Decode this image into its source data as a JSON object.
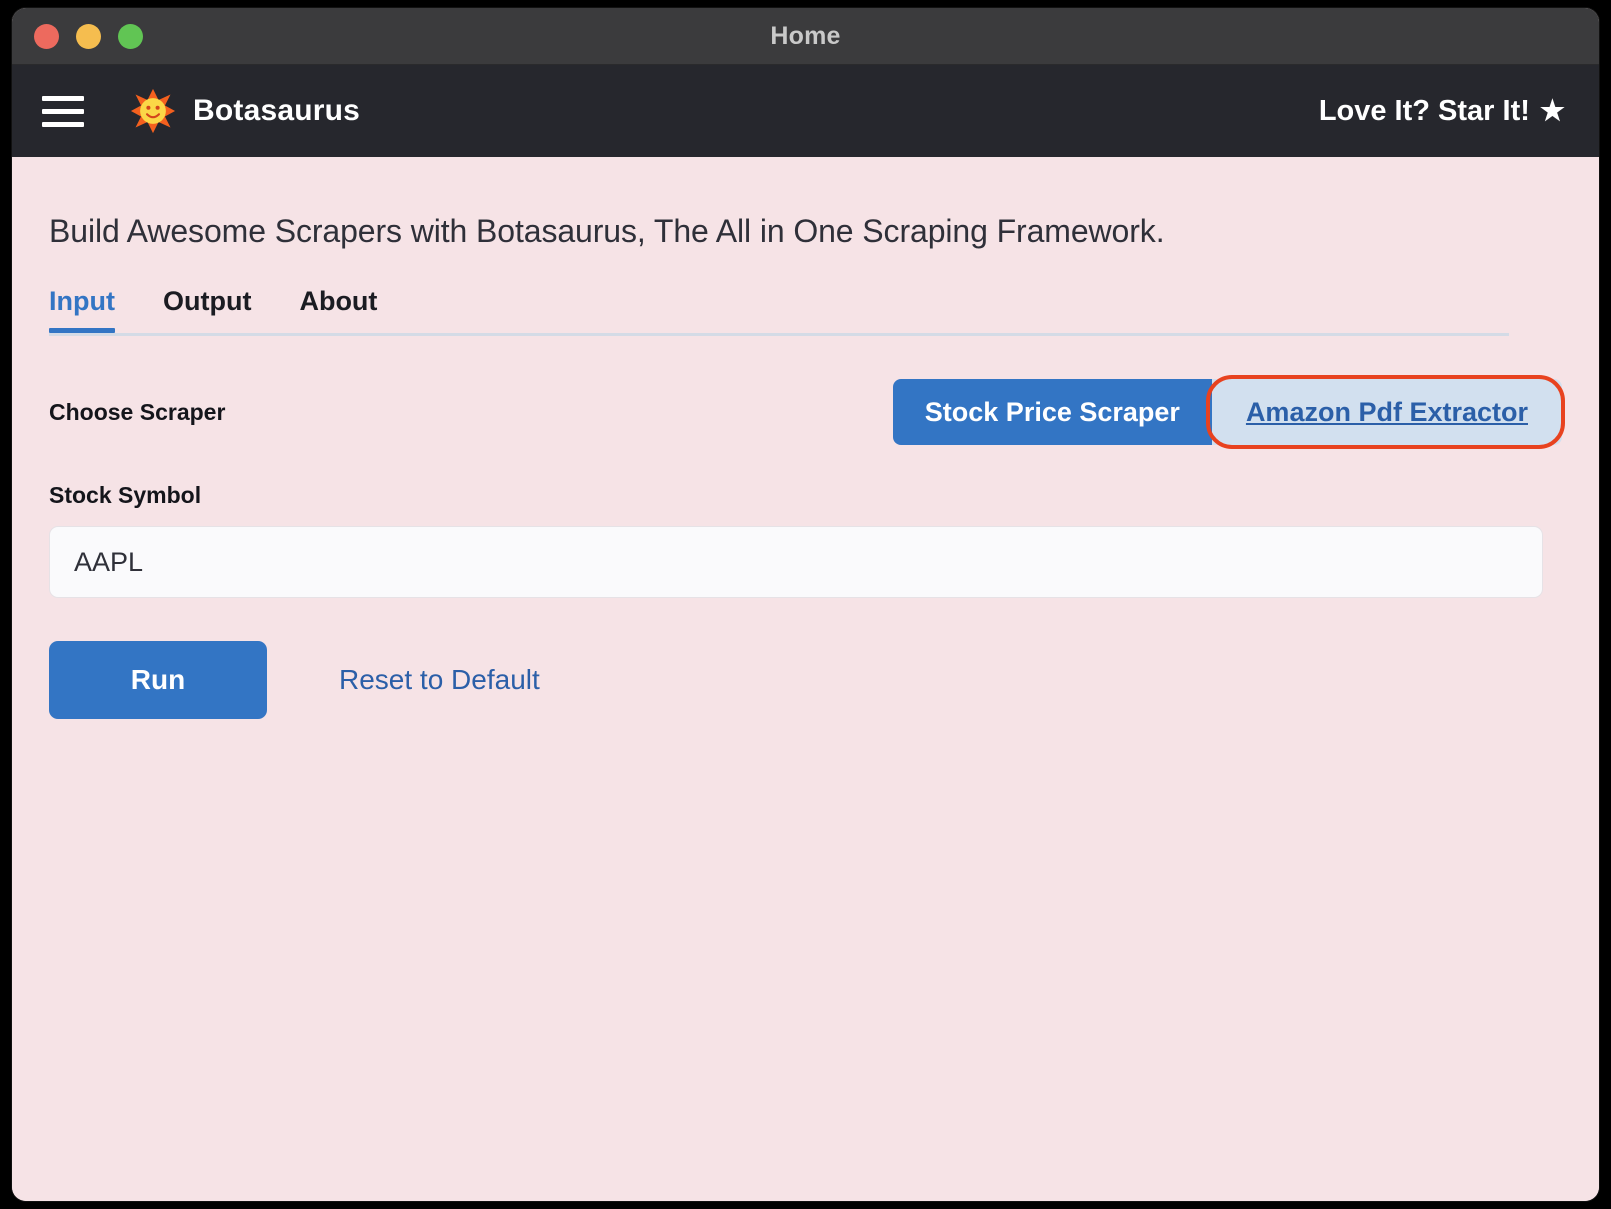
{
  "window": {
    "title": "Home",
    "traffic_lights": [
      {
        "name": "close",
        "color": "#ed6a5e"
      },
      {
        "name": "minimize",
        "color": "#f5bd4f"
      },
      {
        "name": "maximize",
        "color": "#61c554"
      }
    ]
  },
  "navbar": {
    "menu_icon": "hamburger-menu-icon",
    "logo_icon": "sun-logo-icon",
    "brand": "Botasaurus",
    "star_cta": "Love It? Star It!",
    "star_glyph": "★",
    "background": "#26272d"
  },
  "main": {
    "headline": "Build Awesome Scrapers with Botasaurus, The All in One Scraping Framework.",
    "tabs": [
      {
        "label": "Input",
        "active": true
      },
      {
        "label": "Output",
        "active": false
      },
      {
        "label": "About",
        "active": false
      }
    ],
    "choose_scraper": {
      "label": "Choose Scraper",
      "options": [
        {
          "label": "Stock Price Scraper",
          "selected": true
        },
        {
          "label": "Amazon Pdf Extractor",
          "selected": false,
          "focused": true
        }
      ]
    },
    "stock_symbol": {
      "label": "Stock Symbol",
      "value": "AAPL",
      "placeholder": "Stock Symbol"
    },
    "run_label": "Run",
    "reset_label": "Reset to Default"
  },
  "colors": {
    "page_background": "#f6e3e6",
    "accent_blue": "#3375c4",
    "link_blue": "#2b5fa8",
    "focus_ring_red": "#e8421f",
    "segment_unselected": "#d2e0ef"
  }
}
